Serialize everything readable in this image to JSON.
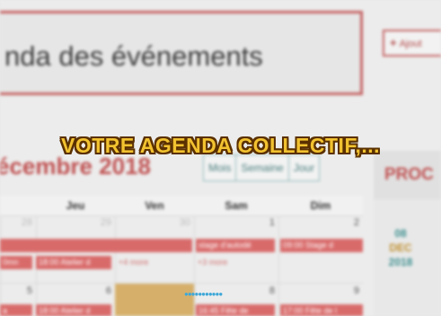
{
  "header": {
    "title": "nda des événements",
    "add_label": "Ajout"
  },
  "calendar": {
    "month_title": "écembre 2018",
    "views": [
      "Mois",
      "Semaine",
      "Jour"
    ],
    "day_headers": [
      "",
      "Jeu",
      "Ven",
      "Sam",
      "Dim"
    ],
    "week1": {
      "nums": [
        "28",
        "29",
        "30",
        "1",
        "2"
      ],
      "bar_event": "",
      "events": [
        "18:00 Atelier d",
        "stage d'autodé",
        "09:00 Stage d"
      ],
      "more": [
        "+4 more",
        "+3 more"
      ],
      "left_event": "0mn"
    },
    "week2": {
      "nums": [
        "5",
        "6",
        "",
        "8",
        "9"
      ],
      "events": [
        "18:00 Atelier d",
        "16:45 Fête de",
        "17:00 Fête de l"
      ],
      "left_event": "a"
    }
  },
  "upcoming": {
    "title": "PROC",
    "day": "08",
    "month": "DEC",
    "year": "2018"
  },
  "overlay": {
    "caption": "VOTRE AGENDA COLLECTIF,..."
  },
  "loader": {
    "dots": "●●●●●●●●●●●"
  }
}
